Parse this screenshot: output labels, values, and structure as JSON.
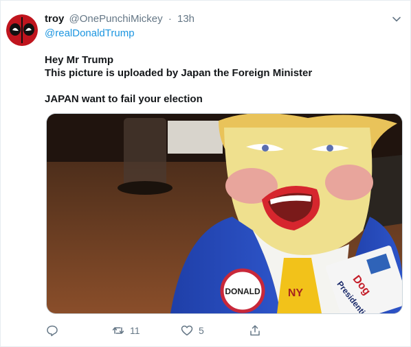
{
  "tweet": {
    "display_name": "troy",
    "handle": "@OnePunchiMickey",
    "separator": "·",
    "time": "13h",
    "replying_to": "@realDonaldTrump",
    "lines": [
      "Hey Mr Trump",
      "This picture is uploaded by Japan the Foreign Minister",
      "JAPAN want to fail your election"
    ],
    "image": {
      "badge_text": "DONALD",
      "tie_text": "NY",
      "tag_line1": "Presidential",
      "tag_line2": "Dog"
    }
  },
  "actions": {
    "reply_icon": "reply-icon",
    "retweet_icon": "retweet-icon",
    "retweet_count": "11",
    "like_icon": "heart-icon",
    "like_count": "5",
    "share_icon": "share-icon"
  },
  "colors": {
    "link": "#1b95e0",
    "muted": "#657786",
    "text": "#14171a"
  }
}
